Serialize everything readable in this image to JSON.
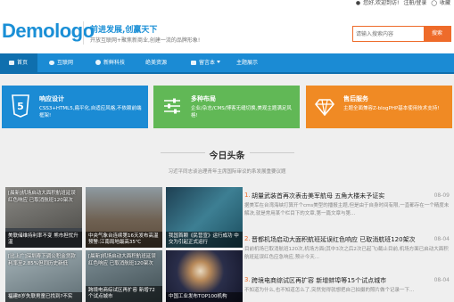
{
  "topbar": {
    "greeting": "您好,欢迎到访!",
    "login": "注册/登录",
    "fav": "收藏"
  },
  "header": {
    "logo": "Demologo",
    "slogan": "前进发展,创赢天下",
    "slogan_sub": "开放互联网+聚焦新商业,创建一流的品牌形象!",
    "search_placeholder": "请输入搜索内容",
    "search_button": "搜索"
  },
  "nav": {
    "items": [
      {
        "label": "首页",
        "icon": "home-icon"
      },
      {
        "label": "互联网",
        "icon": "cloud-icon"
      },
      {
        "label": "新鲜科技",
        "icon": "plus-circle-icon"
      },
      {
        "label": "绝美资源",
        "icon": ""
      },
      {
        "label": "留言本",
        "icon": "book-icon",
        "dropdown": true
      },
      {
        "label": "主题展示",
        "icon": ""
      }
    ]
  },
  "features": [
    {
      "title": "响应设计",
      "desc": "CSS3+HTML5,扁平化,自适应风格,不依赖前端框架!",
      "icon": "html5-icon",
      "color": "#1b8bd4"
    },
    {
      "title": "多种布局",
      "desc": "企业/杂志/CMS/博客无缝切换,美观主题满足风格!",
      "icon": "sliders-icon",
      "color": "#61b856"
    },
    {
      "title": "售后服务",
      "desc": "主题全面兼容Z-blogPHP基本使用技术支持!",
      "icon": "gem-icon",
      "color": "#f08a24"
    }
  ],
  "headline": {
    "title": "今日头条",
    "subtitle": "习近平同志谈治理青年主席国际审议的系发展重要议题"
  },
  "tiles": [
    {
      "caption": "[晨新]机场启动大面积航班延误红色响应 已取消航班120架次",
      "bottom": "",
      "tone": "#6b6a67"
    },
    {
      "caption": "",
      "bottom": "中央气象台连续第16天发布高温预警:江南局地最高35℃",
      "tone": "#7a6a55"
    },
    {
      "caption": "",
      "bottom": "我国首颗《民营宣》运行成功 中交为引起正式运行",
      "tone": "#2d5a6c"
    },
    {
      "caption": "",
      "bottom": "美联储维持利率不变 熊市担忧升温",
      "tone": "#4a4f55"
    },
    {
      "caption": "[比上广]深圳寿下调公积金贷款利率至2.85%但同历史新低",
      "bottom": "福建8岁失联男童已找到?不实",
      "tone": "#7d8a8e"
    },
    {
      "caption": "[晨新]机场启动大面积航班延误红色响应 已取消航班120架次",
      "bottom": "跨境电商综试区再扩容 新增72个试点城市",
      "tone": "#5d6b72"
    },
    {
      "caption": "",
      "bottom": "中国工业发布TOP100机构",
      "tone": "#3a3f5a"
    }
  ],
  "news": [
    {
      "num": "1.",
      "title": "胡量武装首再次表击美军航母 五角大楼未予证实",
      "date": "08-09",
      "snippet": "据美军在台湾海峡打算开个cms美型的播报主题,但是由于自身时间有限,一直都存在一个精度未解决,就是常用某个栏目下的文章,第一篇文章与第..."
    },
    {
      "num": "2.",
      "title": "晋都机场启动大面积航班延误红色响应 已取消航班120架次",
      "date": "08-04",
      "snippet": "目前机场已取消航班120次,机场方面(其中3次之后2次已起飞)截止目前,机场方面已启动大面积航班延误红色应急响应,预计今天..."
    },
    {
      "num": "3.",
      "title": "跨境电商综试区再扩容 新增蚌埠等15个试点城市",
      "date": "08-04",
      "snippet": "不知道为什么,也不知道怎么了,突然觉得就想把自己拍摄的照片做个记录一下..."
    }
  ]
}
